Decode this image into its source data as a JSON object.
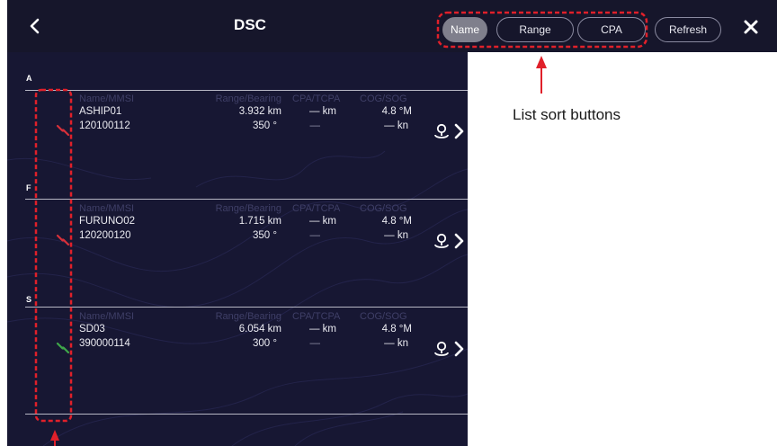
{
  "titlebar": {
    "back_icon": "chevron-left-icon",
    "title": "DSC",
    "sort_buttons": [
      "Name",
      "Range",
      "CPA"
    ],
    "active_sort": "Name",
    "refresh_label": "Refresh",
    "close_icon": "close-icon",
    "bar_color": "#16162b",
    "active_button_color": "#7f7f8c"
  },
  "list": {
    "headers": {
      "name": "Name/MMSI",
      "range": "Range/Bearing",
      "cpa": "CPA/TCPA",
      "cog": "COG/SOG"
    },
    "sections": [
      {
        "letter": "A",
        "entry": {
          "name": "ASHIP01",
          "mmsi": "120100112",
          "range": "3.932 km",
          "bearing": "350 °",
          "cpa": "— km",
          "tcpa": "—",
          "cog": "4.8 °M",
          "sog": "— kn",
          "icon": "vessel-link-icon",
          "icon_color": "#d8303a"
        }
      },
      {
        "letter": "F",
        "entry": {
          "name": "FURUNO02",
          "mmsi": "120200120",
          "range": "1.715 km",
          "bearing": "350 °",
          "cpa": "— km",
          "tcpa": "—",
          "cog": "4.8 °M",
          "sog": "— kn",
          "icon": "vessel-link-icon",
          "icon_color": "#d8303a"
        }
      },
      {
        "letter": "S",
        "entry": {
          "name": "SD03",
          "mmsi": "390000114",
          "range": "6.054 km",
          "bearing": "300 °",
          "cpa": "— km",
          "tcpa": "—",
          "cog": "4.8 °M",
          "sog": "— kn",
          "icon": "vessel-link-icon",
          "icon_color": "#3fa84a"
        }
      }
    ],
    "background_color": "#171733"
  },
  "annotation": {
    "label": "List sort buttons",
    "highlight_color": "#e0202a"
  }
}
